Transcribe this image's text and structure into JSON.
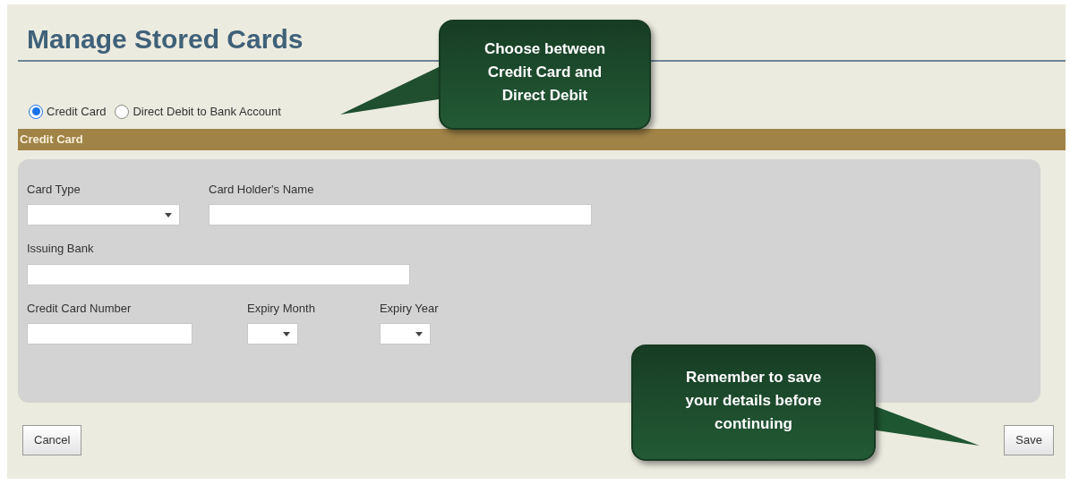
{
  "title": "Manage Stored Cards",
  "payment_methods": [
    {
      "label": "Credit Card",
      "selected": true
    },
    {
      "label": "Direct Debit to Bank Account",
      "selected": false
    }
  ],
  "section_header": "Credit Card",
  "field_rows": [
    [
      {
        "label": "Card Type",
        "kind": "select"
      },
      {
        "label": "Card Holder's Name",
        "kind": "text"
      }
    ],
    [
      {
        "label": "Issuing Bank",
        "kind": "text"
      }
    ],
    [
      {
        "label": "Credit Card Number",
        "kind": "text"
      },
      {
        "label": "Expiry Month",
        "kind": "select"
      },
      {
        "label": "Expiry Year",
        "kind": "select"
      }
    ]
  ],
  "buttons": {
    "cancel": "Cancel",
    "save": "Save"
  },
  "callouts": [
    {
      "text": "Choose between Credit Card and Direct Debit"
    },
    {
      "text": "Remember to save your details before continuing"
    }
  ]
}
